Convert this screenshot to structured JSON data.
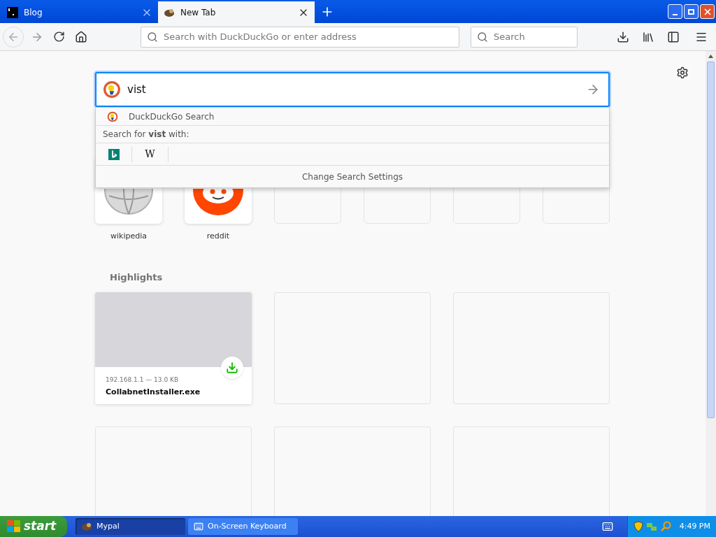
{
  "tabs": [
    {
      "title": "Blog",
      "selected": false
    },
    {
      "title": "New Tab",
      "selected": true
    }
  ],
  "toolbar": {
    "address_placeholder": "Search with DuckDuckGo or enter address",
    "search_placeholder": "Search"
  },
  "newtab_search": {
    "value": "vist"
  },
  "dropdown": {
    "suggestion": "DuckDuckGo Search",
    "search_with": "Search for **vist** with:",
    "engines": [
      {
        "kind": "bing"
      },
      {
        "kind": "wikipedia",
        "glyph": "W"
      }
    ],
    "settings": "Change Search Settings"
  },
  "top_sites": [
    {
      "kind": "wikipedia",
      "label": "wikipedia"
    },
    {
      "kind": "reddit",
      "label": "reddit"
    },
    {
      "kind": "empty"
    },
    {
      "kind": "empty"
    },
    {
      "kind": "empty"
    },
    {
      "kind": "empty"
    }
  ],
  "highlights": {
    "title": "Highlights",
    "cards": [
      {
        "kind": "download",
        "meta": "192.168.1.1 — 13.0 KB",
        "title": "CollabnetInstaller.exe"
      },
      {
        "kind": "empty"
      },
      {
        "kind": "empty"
      },
      {
        "kind": "empty"
      },
      {
        "kind": "empty"
      },
      {
        "kind": "empty"
      }
    ]
  },
  "taskbar": {
    "start": "start",
    "items": [
      {
        "title": "Mypal",
        "selected": true
      },
      {
        "title": "On-Screen Keyboard",
        "selected": false
      }
    ],
    "clock": "4:49 PM"
  }
}
